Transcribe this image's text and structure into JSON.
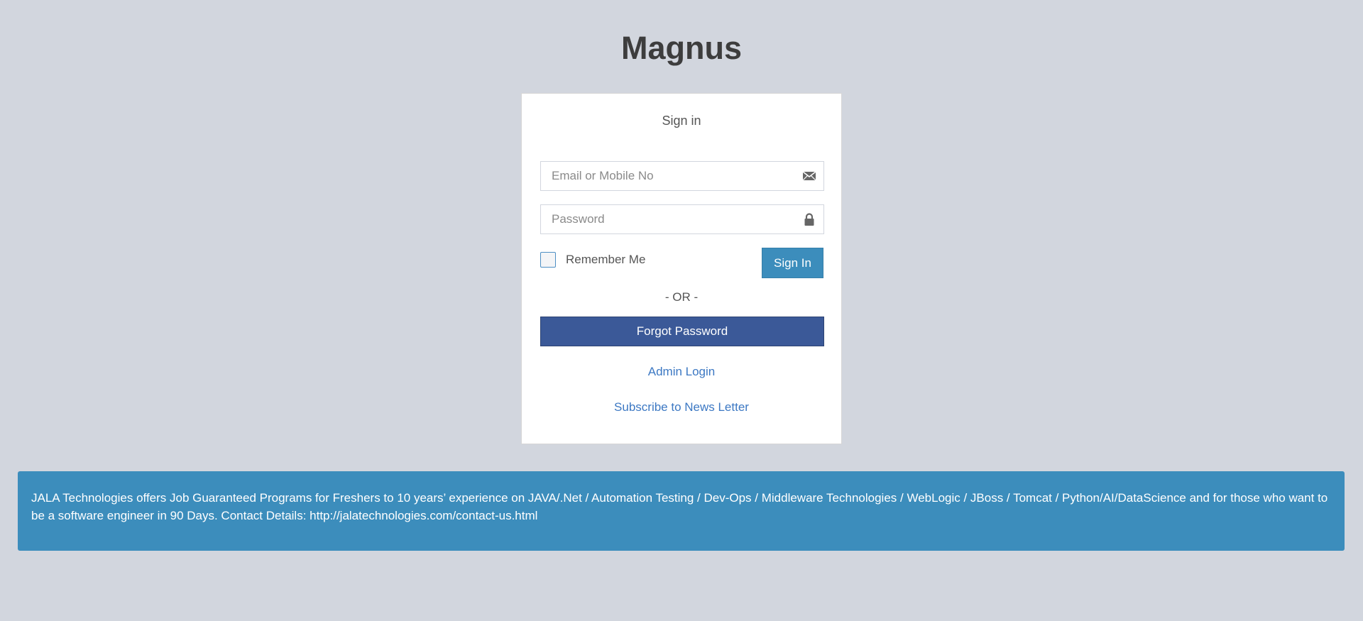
{
  "brand": {
    "title": "Magnus"
  },
  "login": {
    "heading": "Sign in",
    "email_placeholder": "Email or Mobile No",
    "email_icon": "envelope-icon",
    "password_placeholder": "Password",
    "password_icon": "lock-icon",
    "remember_label": "Remember Me",
    "signin_label": "Sign In",
    "or_text": "- OR -",
    "forgot_label": "Forgot Password",
    "admin_link": "Admin Login",
    "newsletter_link": "Subscribe to News Letter"
  },
  "notice": {
    "text": "JALA Technologies offers Job Guaranteed Programs for Freshers to 10 years’ experience on JAVA/.Net / Automation Testing / Dev-Ops / Middleware Technologies / WebLogic / JBoss / Tomcat / Python/AI/DataScience and for those who want to be a software engineer in 90 Days. Contact Details: http://jalatechnologies.com/contact-us.html"
  },
  "colors": {
    "background": "#d2d6de",
    "primary": "#3c8dbc",
    "facebook_blue": "#3b5998",
    "link": "#3c78c3"
  }
}
